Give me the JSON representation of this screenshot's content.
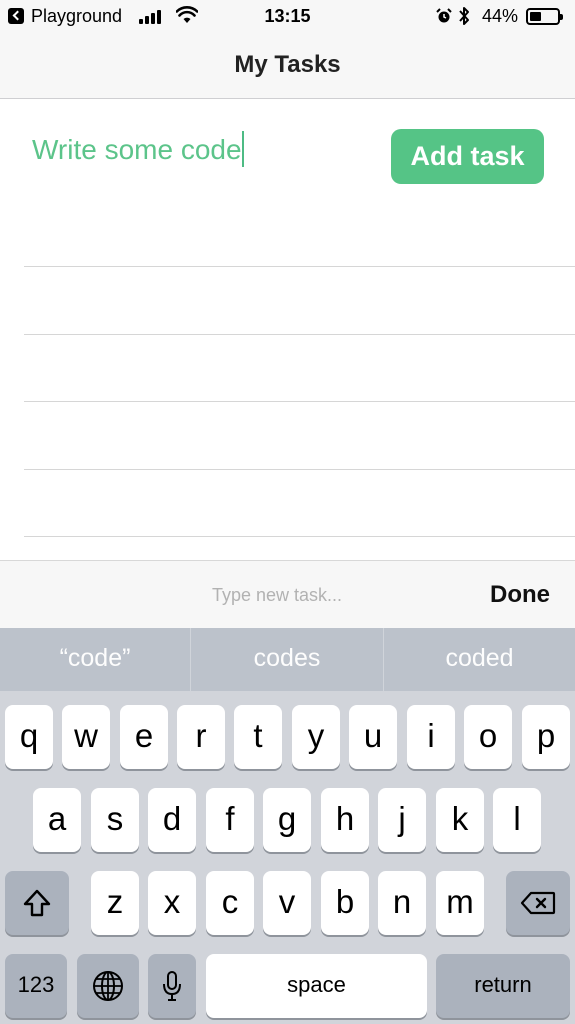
{
  "status_bar": {
    "back_app": "Playground",
    "time": "13:15",
    "battery_percent": "44%",
    "battery_level": 0.44
  },
  "nav": {
    "title": "My Tasks"
  },
  "task_form": {
    "input_value": "Write some code",
    "add_button": "Add task",
    "accent_color": "#55c486"
  },
  "accessory": {
    "placeholder": "Type new task...",
    "done": "Done"
  },
  "keyboard": {
    "suggestions": [
      "“code”",
      "codes",
      "coded"
    ],
    "row1": [
      "q",
      "w",
      "e",
      "r",
      "t",
      "y",
      "u",
      "i",
      "o",
      "p"
    ],
    "row2": [
      "a",
      "s",
      "d",
      "f",
      "g",
      "h",
      "j",
      "k",
      "l"
    ],
    "row3": [
      "z",
      "x",
      "c",
      "v",
      "b",
      "n",
      "m"
    ],
    "numbers_key": "123",
    "space_key": "space",
    "return_key": "return",
    "icons": [
      "shift-icon",
      "backspace-icon",
      "globe-icon",
      "microphone-icon"
    ]
  }
}
